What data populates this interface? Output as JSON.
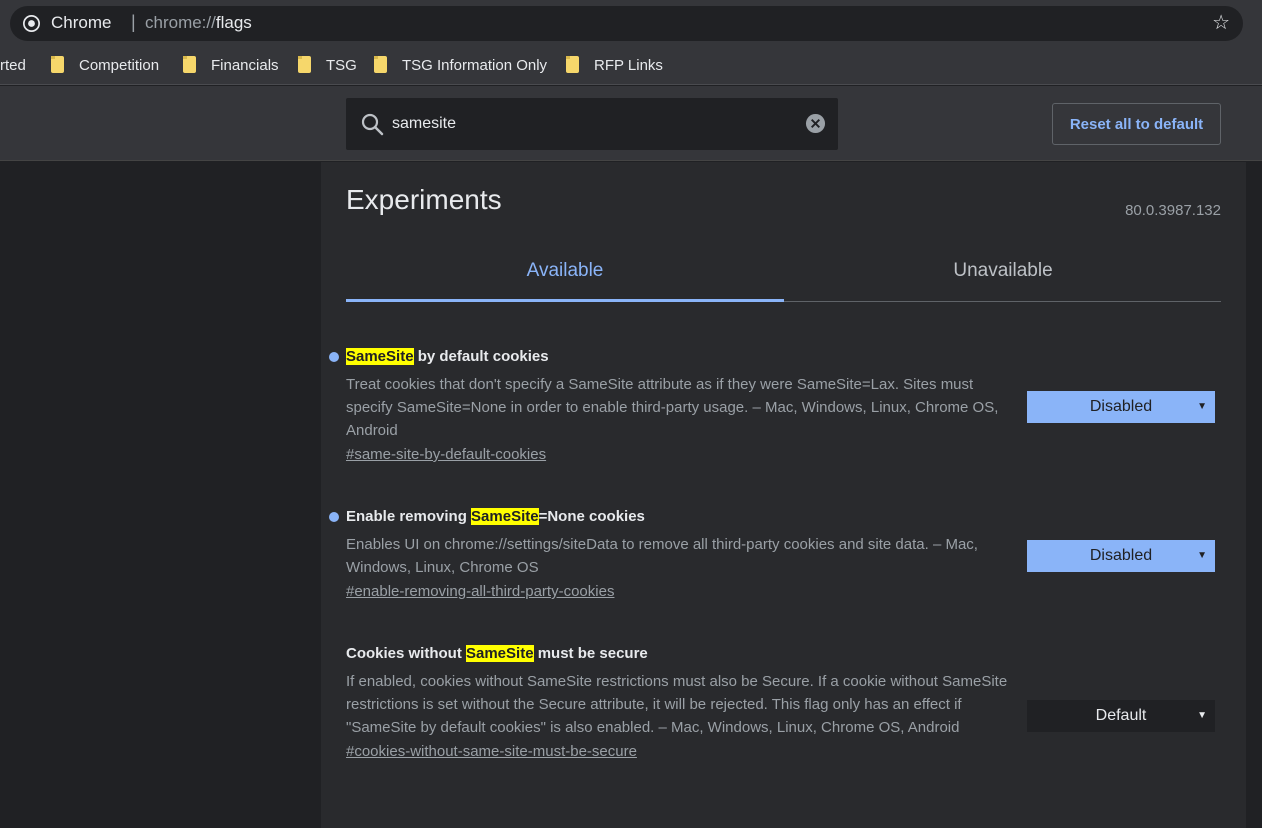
{
  "browser": {
    "site_name": "Chrome",
    "separator": "|",
    "url_scheme": "chrome://",
    "url_host": "flags"
  },
  "bookmarks": [
    {
      "label": "rted",
      "folder": false
    },
    {
      "label": "Competition",
      "folder": true
    },
    {
      "label": "Financials",
      "folder": true
    },
    {
      "label": "TSG",
      "folder": true
    },
    {
      "label": "TSG Information Only",
      "folder": true
    },
    {
      "label": "RFP Links",
      "folder": true
    }
  ],
  "search": {
    "value": "samesite"
  },
  "reset_label": "Reset all to default",
  "header": {
    "title": "Experiments",
    "version": "80.0.3987.132"
  },
  "tabs": [
    {
      "label": "Available",
      "active": true
    },
    {
      "label": "Unavailable",
      "active": false
    }
  ],
  "flags": [
    {
      "name_pre": "",
      "name_highlight": "SameSite",
      "name_post": " by default cookies",
      "description": "Treat cookies that don't specify a SameSite attribute as if they were SameSite=Lax. Sites must specify SameSite=None in order to enable third-party usage. – Mac, Windows, Linux, Chrome OS, Android",
      "link": "#same-site-by-default-cookies",
      "select_value": "Disabled",
      "modified": true
    },
    {
      "name_pre": "Enable removing ",
      "name_highlight": "SameSite",
      "name_post": "=None cookies",
      "description": "Enables UI on chrome://settings/siteData to remove all third-party cookies and site data. – Mac, Windows, Linux, Chrome OS",
      "link": "#enable-removing-all-third-party-cookies",
      "select_value": "Disabled",
      "modified": true
    },
    {
      "name_pre": "Cookies without ",
      "name_highlight": "SameSite",
      "name_post": " must be secure",
      "description": "If enabled, cookies without SameSite restrictions must also be Secure. If a cookie without SameSite restrictions is set without the Secure attribute, it will be rejected. This flag only has an effect if \"SameSite by default cookies\" is also enabled. – Mac, Windows, Linux, Chrome OS, Android",
      "link": "#cookies-without-same-site-must-be-secure",
      "select_value": "Default",
      "modified": false
    }
  ],
  "colors": {
    "accent": "#8ab4f8",
    "highlight": "#ffff00",
    "background": "#202124",
    "surface": "#292a2d"
  },
  "icons": {
    "chrome": "chrome-logo-icon",
    "star": "star-icon",
    "folder": "folder-icon",
    "search": "search-icon",
    "clear": "clear-icon",
    "dropdown": "dropdown-arrow-icon"
  }
}
